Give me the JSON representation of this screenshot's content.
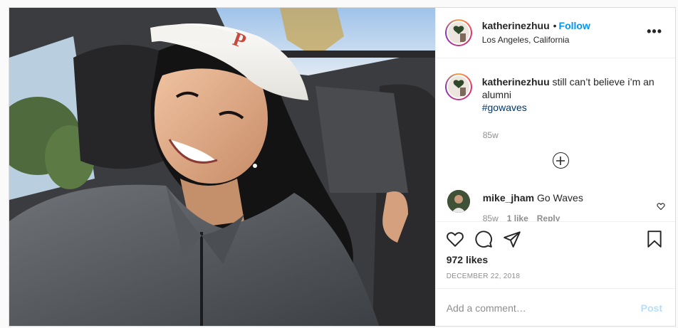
{
  "post": {
    "username": "katherinezhuu",
    "follow_label": "Follow",
    "location": "Los Angeles, California",
    "more_label": "•••",
    "caption": {
      "username": "katherinezhuu",
      "text": "still can’t believe i’m an alumni",
      "hashtag": "#gowaves",
      "time": "85w"
    },
    "comments": [
      {
        "username": "mike_jham",
        "text": "Go Waves",
        "time": "85w",
        "likes": "1 like",
        "reply_label": "Reply"
      }
    ],
    "likes": "972 likes",
    "date": "December 22, 2018",
    "add_comment": {
      "placeholder": "Add a comment…",
      "post_label": "Post"
    }
  },
  "colors": {
    "follow_blue": "#0095f6",
    "hashtag_blue": "#00376b",
    "post_disabled": "#b2dffc",
    "secondary_text": "#8e8e8e"
  },
  "icons": [
    "heart-icon",
    "comment-icon",
    "share-icon",
    "bookmark-icon",
    "plus-circle-icon",
    "more-options-icon"
  ]
}
